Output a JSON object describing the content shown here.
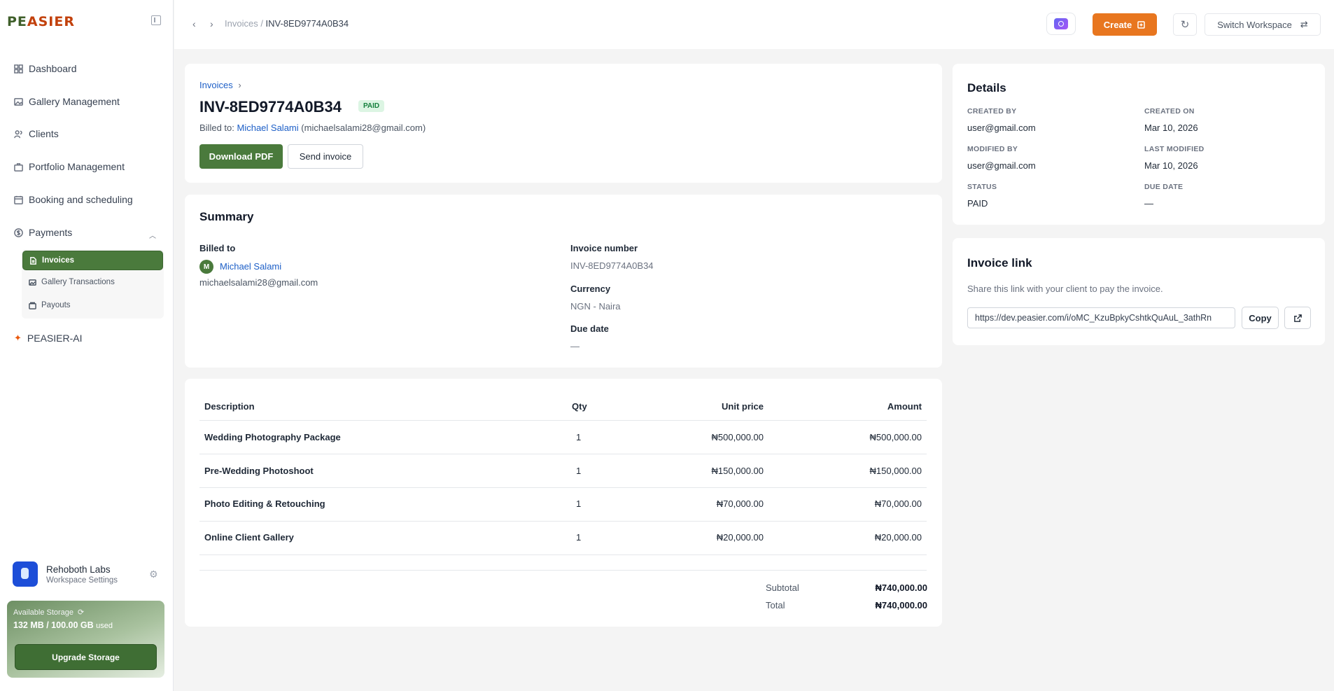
{
  "brand": {
    "logo_part1": "PE",
    "logo_part2": "ASIER"
  },
  "sidebar": {
    "items": [
      {
        "label": "Dashboard"
      },
      {
        "label": "Gallery Management"
      },
      {
        "label": "Clients"
      },
      {
        "label": "Portfolio Management"
      },
      {
        "label": "Booking and scheduling"
      },
      {
        "label": "Payments"
      }
    ],
    "payments_sub": [
      {
        "label": "Invoices"
      },
      {
        "label": "Gallery Transactions"
      },
      {
        "label": "Payouts"
      }
    ],
    "ai_label": "PEASIER-AI",
    "workspace": {
      "name": "Rehoboth Labs",
      "subtitle": "Workspace Settings"
    },
    "storage": {
      "label": "Available Storage",
      "used_value": "132 MB / 100.00 GB",
      "used_suffix": "used",
      "upgrade_label": "Upgrade Storage"
    }
  },
  "topbar": {
    "breadcrumb_parent": "Invoices",
    "breadcrumb_sep": " / ",
    "breadcrumb_current": "INV-8ED9774A0B34",
    "create_label": "Create",
    "switch_label": "Switch Workspace"
  },
  "invoice_header": {
    "breadcrumb": "Invoices",
    "number": "INV-8ED9774A0B34",
    "status_badge": "PAID",
    "billed_prefix": "Billed to:",
    "client_name": "Michael Salami",
    "client_email_paren": "(michaelsalami28@gmail.com)",
    "download_label": "Download PDF",
    "send_label": "Send invoice"
  },
  "summary": {
    "title": "Summary",
    "billed_to_label": "Billed to",
    "client_initial": "M",
    "client_name": "Michael Salami",
    "client_email": "michaelsalami28@gmail.com",
    "invoice_number_label": "Invoice number",
    "invoice_number": "INV-8ED9774A0B34",
    "currency_label": "Currency",
    "currency": "NGN - Naira",
    "due_date_label": "Due date",
    "due_date": "—"
  },
  "line_items": {
    "columns": [
      "Description",
      "Qty",
      "Unit price",
      "Amount"
    ],
    "rows": [
      {
        "description": "Wedding Photography Package",
        "qty": "1",
        "unit_price": "₦500,000.00",
        "amount": "₦500,000.00"
      },
      {
        "description": "Pre-Wedding Photoshoot",
        "qty": "1",
        "unit_price": "₦150,000.00",
        "amount": "₦150,000.00"
      },
      {
        "description": "Photo Editing & Retouching",
        "qty": "1",
        "unit_price": "₦70,000.00",
        "amount": "₦70,000.00"
      },
      {
        "description": "Online Client Gallery",
        "qty": "1",
        "unit_price": "₦20,000.00",
        "amount": "₦20,000.00"
      }
    ],
    "subtotal_label": "Subtotal",
    "subtotal": "₦740,000.00",
    "total_label": "Total",
    "total": "₦740,000.00"
  },
  "details": {
    "title": "Details",
    "created_by_label": "CREATED BY",
    "created_by": "user@gmail.com",
    "created_on_label": "CREATED ON",
    "created_on": "Mar 10, 2026",
    "modified_by_label": "MODIFIED BY",
    "modified_by": "user@gmail.com",
    "last_modified_label": "LAST MODIFIED",
    "last_modified": "Mar 10, 2026",
    "status_label": "STATUS",
    "status": "PAID",
    "due_date_label": "DUE DATE",
    "due_date": "—"
  },
  "invoice_link": {
    "title": "Invoice link",
    "description": "Share this link with your client to pay the invoice.",
    "url": "https://dev.peasier.com/i/oMC_KzuBpkyCshtkQuAuL_3athRn",
    "copy_label": "Copy"
  },
  "colors": {
    "primary_green": "#4a7a3c",
    "accent_orange": "#e8761f",
    "link_blue": "#1d5fc7"
  }
}
